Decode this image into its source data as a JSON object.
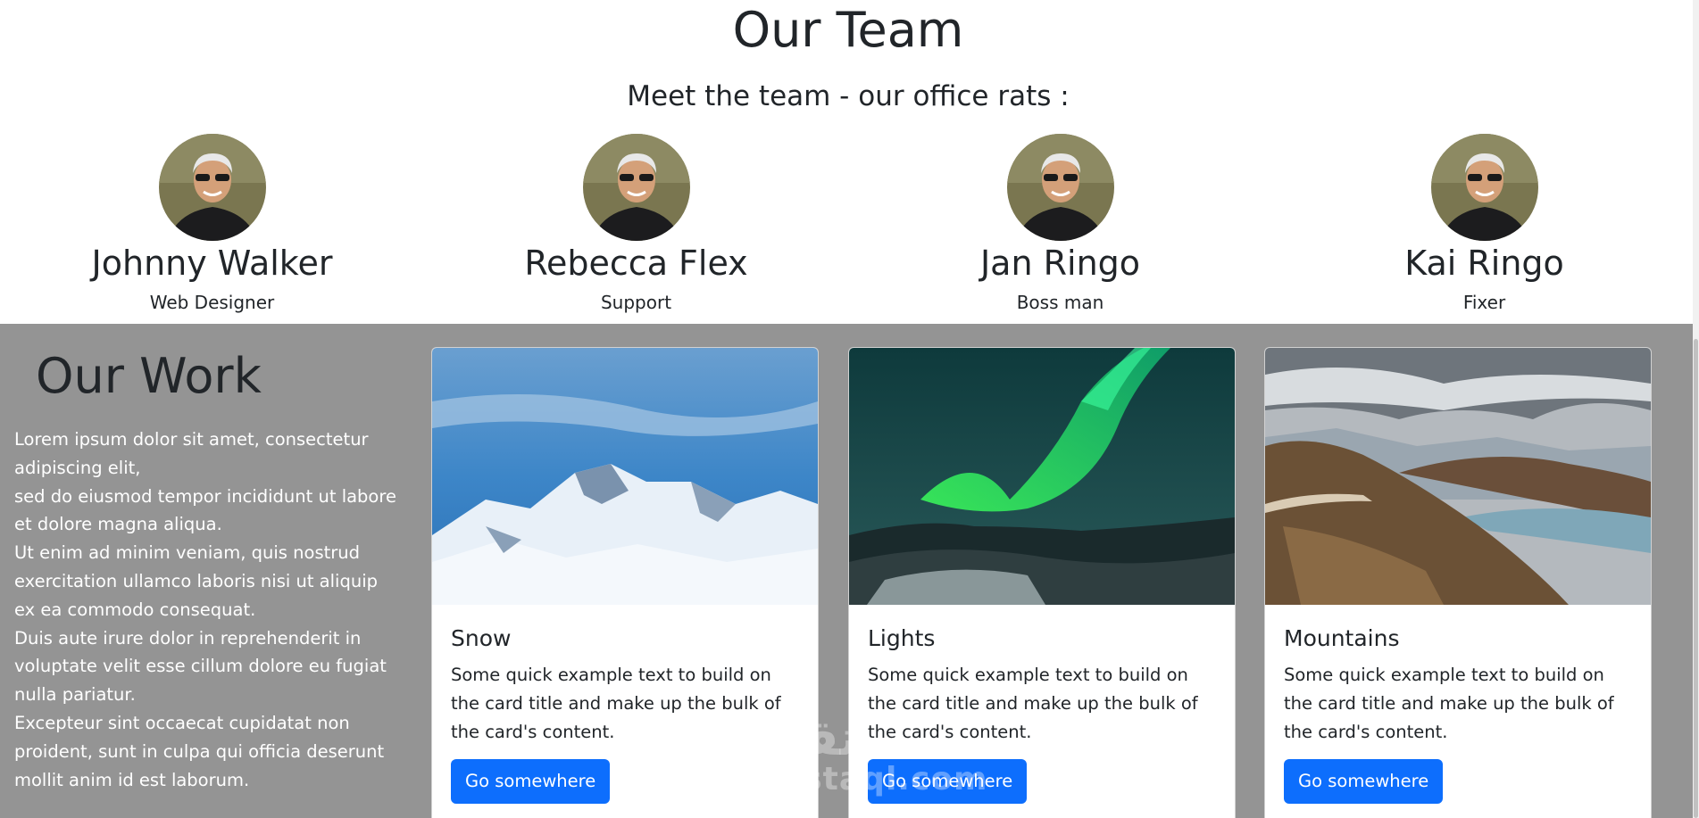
{
  "team": {
    "title": "Our Team",
    "subtitle": "Meet the team - our office rats :",
    "members": [
      {
        "name": "Johnny Walker",
        "role": "Web Designer"
      },
      {
        "name": "Rebecca Flex",
        "role": "Support"
      },
      {
        "name": "Jan Ringo",
        "role": "Boss man"
      },
      {
        "name": "Kai Ringo",
        "role": "Fixer"
      }
    ]
  },
  "work": {
    "title": "Our Work",
    "paragraphs": [
      "Lorem ipsum dolor sit amet, consectetur adipiscing elit,",
      "sed do eiusmod tempor incididunt ut labore et dolore magna aliqua.",
      "Ut enim ad minim veniam, quis nostrud exercitation ullamco laboris nisi ut aliquip ex ea commodo consequat.",
      "Duis aute irure dolor in reprehenderit in voluptate velit esse cillum dolore eu fugiat nulla pariatur.",
      "Excepteur sint occaecat cupidatat non proident, sunt in culpa qui officia deserunt mollit anim id est laborum."
    ],
    "cards": [
      {
        "title": "Snow",
        "text": "Some quick example text to build on the card title and make up the bulk of the card's content.",
        "button": "Go somewhere",
        "image_icon": "snowy-mountains-photo"
      },
      {
        "title": "Lights",
        "text": "Some quick example text to build on the card title and make up the bulk of the card's content.",
        "button": "Go somewhere",
        "image_icon": "aurora-photo"
      },
      {
        "title": "Mountains",
        "text": "Some quick example text to build on the card title and make up the bulk of the card's content.",
        "button": "Go somewhere",
        "image_icon": "mountain-lake-photo"
      }
    ]
  },
  "watermark": {
    "logo": "مستقل",
    "text": "mostaql.com"
  },
  "colors": {
    "work_background": "#949494",
    "button": "#0d6efd",
    "text": "#212529"
  }
}
